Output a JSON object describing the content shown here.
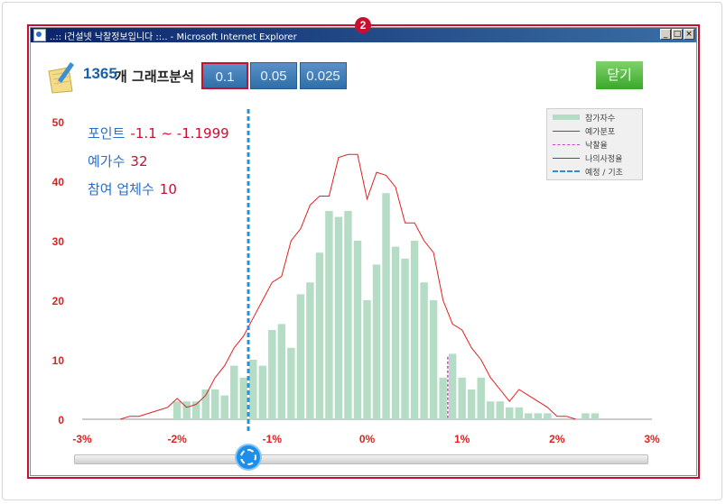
{
  "window": {
    "title": "..:: i건설넷 낙찰정보입니다 ::.. - Microsoft Internet Explorer",
    "min_label": "_",
    "max_label": "□",
    "close_label": "×"
  },
  "badge": "2",
  "header": {
    "count": "1365",
    "count_unit": "개 그래프분석",
    "options": [
      "0.1",
      "0.05",
      "0.025"
    ],
    "selected_option": "0.1",
    "close_label": "닫기"
  },
  "info": {
    "point_label": "포인트",
    "point_value": "-1.1 ~ -1.1999",
    "forecast_label": "예가수",
    "forecast_value": "32",
    "participants_label": "참여 업체수",
    "participants_value": "10"
  },
  "legend": [
    "참가자수",
    "예가분포",
    "낙찰율",
    "나의사정율",
    "예정 / 기초"
  ],
  "colors": {
    "bars": "#b5dcc5",
    "forecast_line": "#e02020",
    "winning_rate": "#d040d0",
    "my_rate": "#1a5fa8",
    "base": "#2b8fd8",
    "axis_text": "#e02020",
    "highlight": "#c8102e"
  },
  "chart_data": {
    "type": "bar",
    "x_tick_labels": [
      "-3%",
      "-2%",
      "-1%",
      "0%",
      "1%",
      "2%",
      "3%"
    ],
    "y_tick_labels": [
      "0",
      "10",
      "20",
      "30",
      "40",
      "50"
    ],
    "xlim": [
      -3,
      3
    ],
    "ylim": [
      0,
      50
    ],
    "bar_width": 0.1,
    "bars": {
      "x": [
        -2.0,
        -1.9,
        -1.8,
        -1.7,
        -1.6,
        -1.5,
        -1.4,
        -1.3,
        -1.2,
        -1.1,
        -1.0,
        -0.9,
        -0.8,
        -0.7,
        -0.6,
        -0.5,
        -0.4,
        -0.3,
        -0.2,
        -0.1,
        0.0,
        0.1,
        0.2,
        0.3,
        0.4,
        0.5,
        0.6,
        0.7,
        0.8,
        0.9,
        1.0,
        1.1,
        1.2,
        1.3,
        1.4,
        1.5,
        1.6,
        1.7,
        1.8,
        1.9,
        2.0,
        2.1,
        2.2,
        2.3,
        2.4
      ],
      "y": [
        3,
        3,
        3,
        5,
        5,
        4,
        9,
        7,
        10,
        9,
        15,
        16,
        12,
        21,
        23,
        28,
        35,
        34,
        35,
        30,
        20,
        26,
        38,
        29,
        27,
        30,
        23,
        20,
        7,
        11,
        7,
        5,
        7,
        3,
        3,
        2,
        2,
        1,
        1,
        1,
        0,
        0,
        0,
        1,
        1
      ]
    },
    "series": [
      {
        "name": "예가분포",
        "x": [
          -2.6,
          -2.5,
          -2.4,
          -2.3,
          -2.2,
          -2.1,
          -2.0,
          -1.9,
          -1.8,
          -1.7,
          -1.6,
          -1.5,
          -1.4,
          -1.3,
          -1.2,
          -1.1,
          -1.0,
          -0.9,
          -0.8,
          -0.7,
          -0.6,
          -0.5,
          -0.4,
          -0.3,
          -0.2,
          -0.1,
          0.0,
          0.1,
          0.2,
          0.3,
          0.4,
          0.5,
          0.6,
          0.7,
          0.8,
          0.9,
          1.0,
          1.1,
          1.2,
          1.3,
          1.4,
          1.5,
          1.6,
          1.7,
          1.8,
          1.9,
          2.0,
          2.1,
          2.2
        ],
        "y": [
          0,
          0.5,
          0.5,
          1,
          1.5,
          2,
          3.5,
          2,
          2.5,
          4,
          7,
          9,
          12,
          14,
          17,
          20,
          23,
          24,
          30,
          32,
          36,
          37.5,
          37.5,
          44,
          44.5,
          44.5,
          37,
          41.5,
          41,
          39,
          33,
          33,
          30,
          28,
          20,
          16,
          15,
          12,
          10,
          7,
          5,
          3,
          5,
          4,
          3,
          2,
          0.5,
          0.5,
          0
        ]
      }
    ],
    "markers": {
      "base_x": -1.25,
      "winning_rate_x": 0.85,
      "winning_rate_y": 10.5
    }
  },
  "slider": {
    "value_percent": -1.25
  }
}
